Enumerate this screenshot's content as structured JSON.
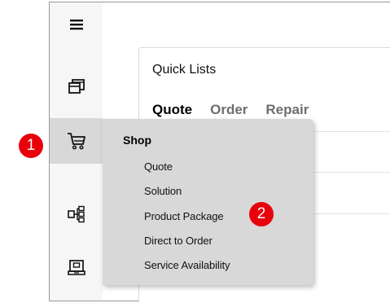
{
  "sidebar": {
    "items": [
      {
        "icon": "menu-icon"
      },
      {
        "icon": "windows-icon"
      },
      {
        "icon": "cart-icon",
        "active": true
      },
      {
        "icon": "hierarchy-icon"
      },
      {
        "icon": "laptop-icon"
      }
    ]
  },
  "quick_lists": {
    "title": "Quick Lists",
    "tabs": [
      "Quote",
      "Order",
      "Repair"
    ]
  },
  "shop_menu": {
    "heading": "Shop",
    "items": [
      "Quote",
      "Solution",
      "Product Package",
      "Direct to Order",
      "Service Availability"
    ]
  },
  "callouts": [
    "1",
    "2"
  ],
  "colors": {
    "callout": "#e8000b",
    "flyout_bg": "#d8d8d8",
    "active_item_bg": "#d8d8d8",
    "inactive_tab": "#6e6e6e"
  }
}
